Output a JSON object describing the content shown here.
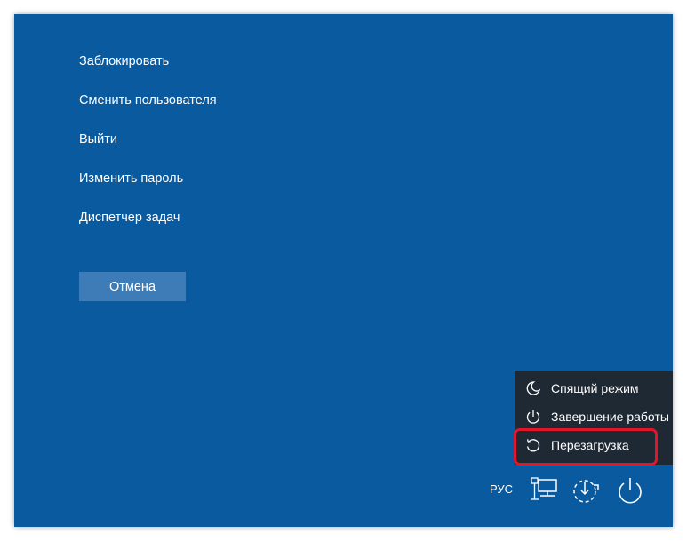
{
  "options": [
    {
      "label": "Заблокировать"
    },
    {
      "label": "Сменить пользователя"
    },
    {
      "label": "Выйти"
    },
    {
      "label": "Изменить пароль"
    },
    {
      "label": "Диспетчер задач"
    }
  ],
  "cancel_label": "Отмена",
  "power_menu": {
    "items": [
      {
        "label": "Спящий режим",
        "icon": "moon-icon"
      },
      {
        "label": "Завершение работы",
        "icon": "power-icon"
      },
      {
        "label": "Перезагрузка",
        "icon": "restart-icon"
      }
    ],
    "highlighted": "Перезагрузка",
    "highlight_color": "#e3152a"
  },
  "tray": {
    "language": "РУС",
    "icons": [
      "network-icon",
      "accessibility-icon",
      "power-icon"
    ]
  },
  "colors": {
    "background": "#0a5aa0",
    "button": "#3e7cb8",
    "menu": "#1f2933"
  }
}
